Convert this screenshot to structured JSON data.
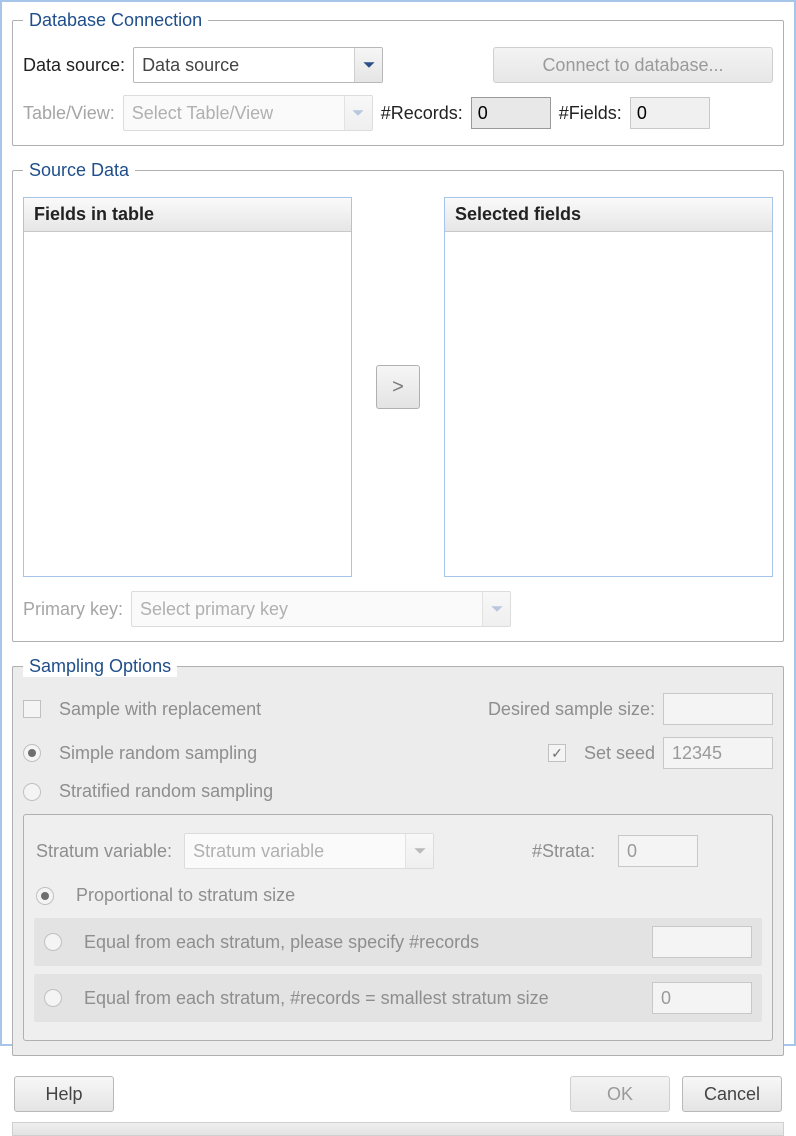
{
  "dbc": {
    "legend": "Database Connection",
    "datasource_label": "Data source:",
    "datasource_value": "Data source",
    "connect_label": "Connect to database...",
    "tableview_label": "Table/View:",
    "tableview_placeholder": "Select Table/View",
    "records_label": "#Records:",
    "records_value": "0",
    "fields_label": "#Fields:",
    "fields_value": "0"
  },
  "source": {
    "legend": "Source Data",
    "left_header": "Fields in table",
    "right_header": "Selected fields",
    "move_right_label": ">",
    "primary_key_label": "Primary key:",
    "primary_key_placeholder": "Select primary key"
  },
  "sampling": {
    "legend": "Sampling Options",
    "replace_label": "Sample with replacement",
    "desired_label": "Desired sample size:",
    "desired_value": "",
    "simple_label": "Simple random sampling",
    "seed_label": "Set seed",
    "seed_value": "12345",
    "stratified_label": "Stratified random sampling",
    "strat_var_label": "Stratum variable:",
    "strat_var_placeholder": "Stratum variable",
    "nstrata_label": "#Strata:",
    "nstrata_value": "0",
    "proportional_label": "Proportional to stratum size",
    "equal_specify_label": "Equal from each stratum, please specify #records",
    "equal_specify_value": "",
    "equal_smallest_label": "Equal from each stratum, #records = smallest stratum size",
    "equal_smallest_value": "0"
  },
  "footer": {
    "help_label": "Help",
    "ok_label": "OK",
    "cancel_label": "Cancel"
  }
}
